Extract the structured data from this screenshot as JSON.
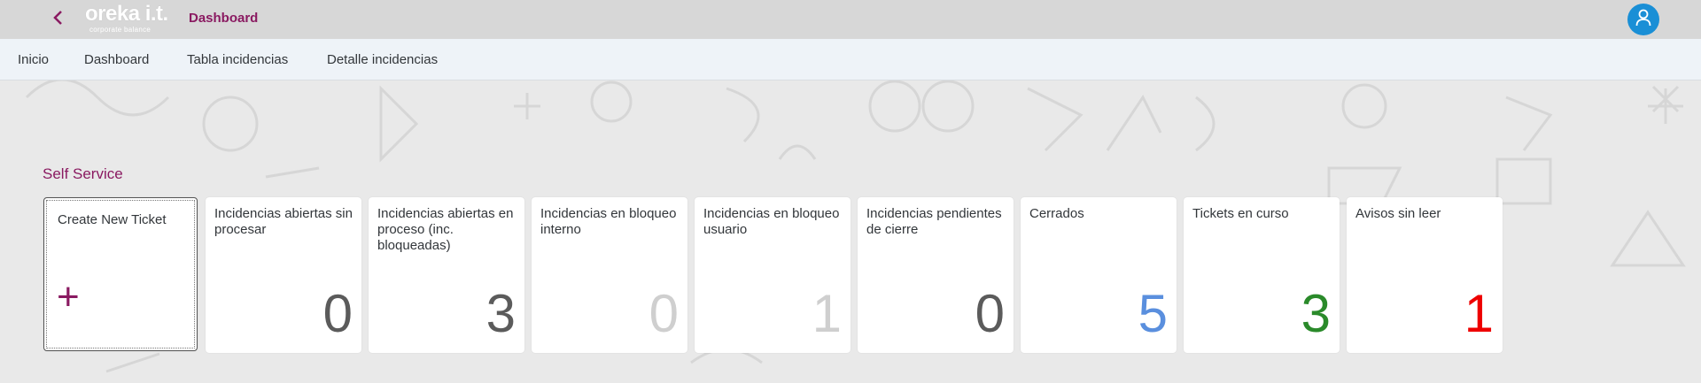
{
  "header": {
    "back_icon": "chevron-left-icon",
    "logo_text": "oreka i.t.",
    "logo_tagline": "corporate balance",
    "title": "Dashboard",
    "user_icon": "user-icon",
    "colors": {
      "accent": "#8a1a61",
      "avatar_bg": "#1a8fd6"
    }
  },
  "nav": {
    "items": [
      {
        "label": "Inicio"
      },
      {
        "label": "Dashboard"
      },
      {
        "label": "Tabla incidencias"
      },
      {
        "label": "Detalle incidencias"
      }
    ]
  },
  "section": {
    "title": "Self Service"
  },
  "tiles": [
    {
      "title": "Create New Ticket",
      "icon": "plus-icon",
      "plus": "+"
    },
    {
      "title": "Incidencias abiertas sin procesar",
      "value": "0",
      "color": "#5b5b5b"
    },
    {
      "title": "Incidencias abiertas en proceso (inc. bloqueadas)",
      "value": "3",
      "color": "#5b5b5b"
    },
    {
      "title": "Incidencias en bloqueo interno",
      "value": "0",
      "color": "#cfcfcf"
    },
    {
      "title": "Incidencias en bloqueo usuario",
      "value": "1",
      "color": "#cfcfcf"
    },
    {
      "title": "Incidencias pendientes de cierre",
      "value": "0",
      "color": "#5b5b5b"
    },
    {
      "title": "Cerrados",
      "value": "5",
      "color": "#5a8fde"
    },
    {
      "title": "Tickets en curso",
      "value": "3",
      "color": "#2a8a2a"
    },
    {
      "title": "Avisos sin leer",
      "value": "1",
      "color": "#ee0000"
    }
  ]
}
